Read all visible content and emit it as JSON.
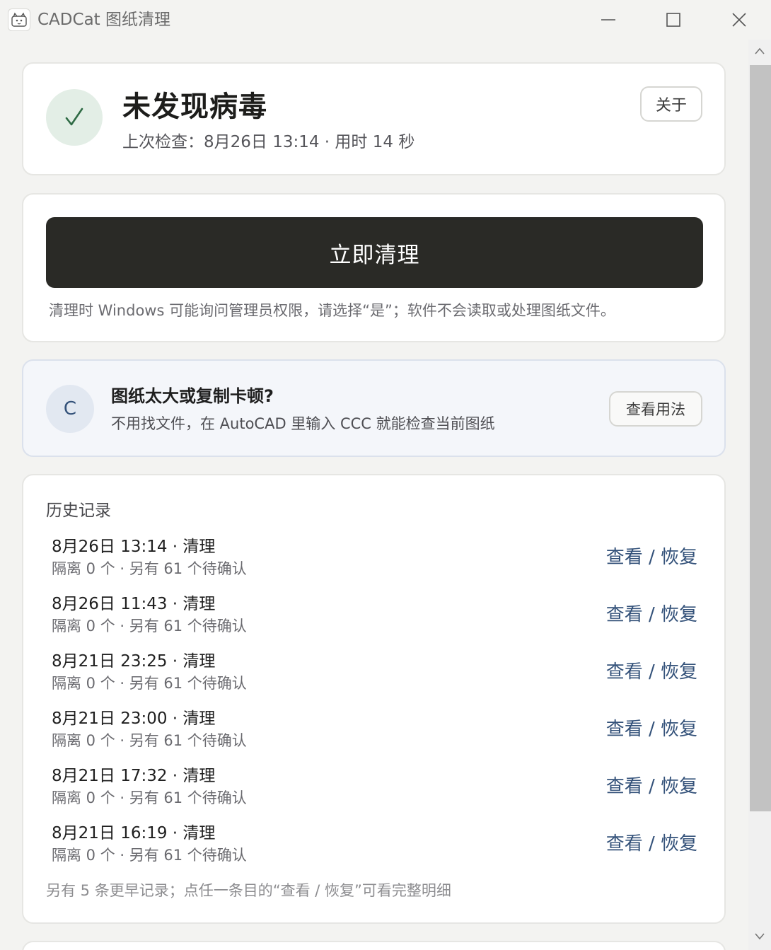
{
  "window": {
    "title": "CADCat 图纸清理",
    "icon": "app-cat-icon"
  },
  "status": {
    "icon": "check-icon",
    "title": "未发现病毒",
    "subtitle": "上次检查：8月26日 13:14 · 用时 14 秒",
    "about_label": "关于"
  },
  "clean": {
    "button_label": "立即清理",
    "note": "清理时 Windows 可能询问管理员权限，请选择“是”；软件不会读取或处理图纸文件。"
  },
  "tip": {
    "badge": "C",
    "title": "图纸太大或复制卡顿?",
    "subtitle": "不用找文件，在 AutoCAD 里输入 CCC 就能检查当前图纸",
    "button_label": "查看用法"
  },
  "history": {
    "title": "历史记录",
    "items": [
      {
        "time": "8月26日 13:14 · 清理",
        "detail": "隔离 0 个 · 另有 61 个待确认",
        "action": "查看 / 恢复"
      },
      {
        "time": "8月26日 11:43 · 清理",
        "detail": "隔离 0 个 · 另有 61 个待确认",
        "action": "查看 / 恢复"
      },
      {
        "time": "8月21日 23:25 · 清理",
        "detail": "隔离 0 个 · 另有 61 个待确认",
        "action": "查看 / 恢复"
      },
      {
        "time": "8月21日 23:00 · 清理",
        "detail": "隔离 0 个 · 另有 61 个待确认",
        "action": "查看 / 恢复"
      },
      {
        "time": "8月21日 17:32 · 清理",
        "detail": "隔离 0 个 · 另有 61 个待确认",
        "action": "查看 / 恢复"
      },
      {
        "time": "8月21日 16:19 · 清理",
        "detail": "隔离 0 个 · 另有 61 个待确认",
        "action": "查看 / 恢复"
      }
    ],
    "footer": "另有 5 条更早记录；点任一条目的“查看 / 恢复”可看完整明细"
  },
  "colors": {
    "accent_dark": "#2a2a26",
    "success": "#2f6b45",
    "link": "#34527a"
  }
}
